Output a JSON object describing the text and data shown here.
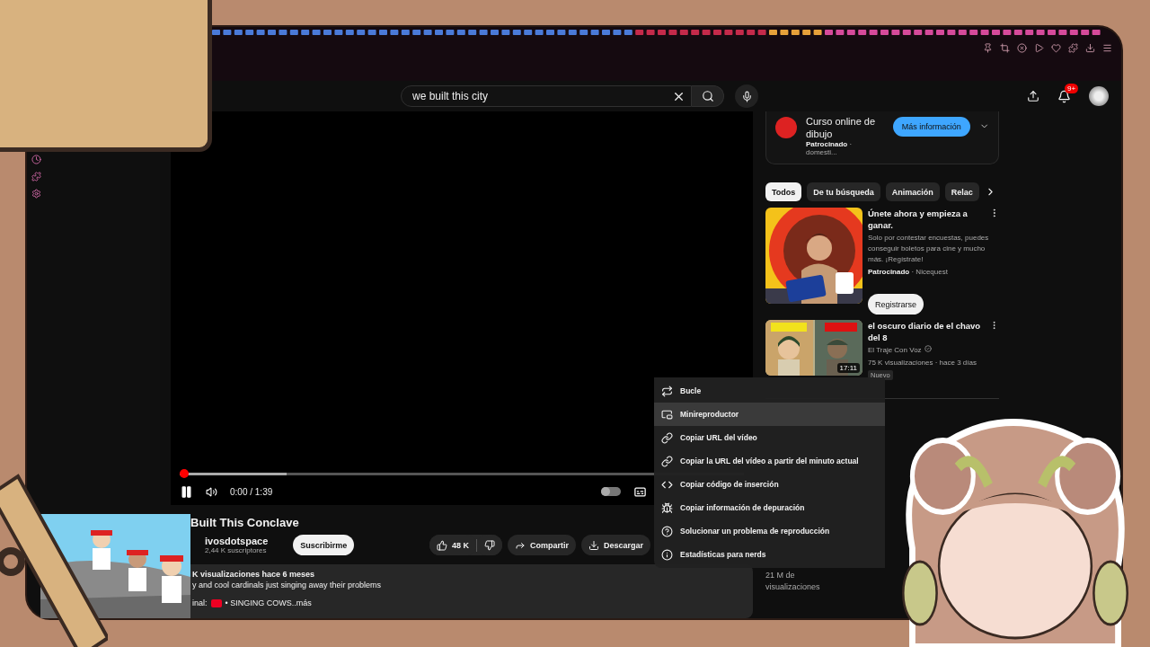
{
  "header": {
    "search": {
      "value": "we built this city"
    },
    "notifications": "9+"
  },
  "player": {
    "playing": true,
    "progress": {
      "level": 0
    },
    "buffer": {
      "level": 0.19
    },
    "time": "0:00 / 1:39",
    "autoplay": {
      "on": false
    }
  },
  "video": {
    "title": "Built This Conclave",
    "channel": "ivosdotspace",
    "subscribers": "2,44 K suscriptores",
    "subscribe": "Suscribirme",
    "likes": "48 K",
    "share": "Compartir",
    "download": "Descargar",
    "description": {
      "stats": "K visualizaciones  hace 6 meses",
      "text": "y and cool cardinals just singing away their problems",
      "link_prefix": "inal:",
      "link": "• SINGING COWS",
      "more": "..más"
    }
  },
  "context_menu": {
    "items": [
      {
        "kind": "loop",
        "label": "Bucle",
        "selected": false
      },
      {
        "kind": "miniplayer",
        "label": "Minireproductor",
        "selected": true
      },
      {
        "kind": "link",
        "label": "Copiar URL del vídeo",
        "selected": false
      },
      {
        "kind": "link",
        "label": "Copiar la URL del vídeo a partir del minuto actual",
        "selected": false
      },
      {
        "kind": "code",
        "label": "Copiar código de inserción",
        "selected": false
      },
      {
        "kind": "debug",
        "label": "Copiar información de depuración",
        "selected": false
      },
      {
        "kind": "help",
        "label": "Solucionar un problema de reproducción",
        "selected": false
      },
      {
        "kind": "info",
        "label": "Estadísticas para nerds",
        "selected": false
      }
    ]
  },
  "sidebar": {
    "ad": {
      "title": "Curso online de dibujo",
      "sponsored": "Patrocinado",
      "advertiser": "· domesti...",
      "button": "Más información"
    },
    "chips": [
      {
        "label": "Todos",
        "selected": true
      },
      {
        "label": "De tu búsqueda",
        "selected": false
      },
      {
        "label": "Animación",
        "selected": false
      },
      {
        "label": "Relac",
        "selected": false
      }
    ],
    "items": [
      {
        "kind": "ad",
        "title": "Únete ahora y empieza a ganar.",
        "text": "Solo por contestar encuestas, puedes conseguir boletos para cine y mucho más. ¡Regístrate!",
        "sponsored": "Patrocinado",
        "advertiser": "· Nicequest",
        "button": "Registrarse"
      },
      {
        "kind": "video",
        "title": "el oscuro diario de el chavo del 8",
        "channel": "El Traje Con Voz",
        "meta": "75 K visualizaciones · hace 3 días",
        "badge": "Nuevo",
        "duration": "17:11"
      }
    ],
    "shorts_views": "21 M de visualizaciones"
  }
}
